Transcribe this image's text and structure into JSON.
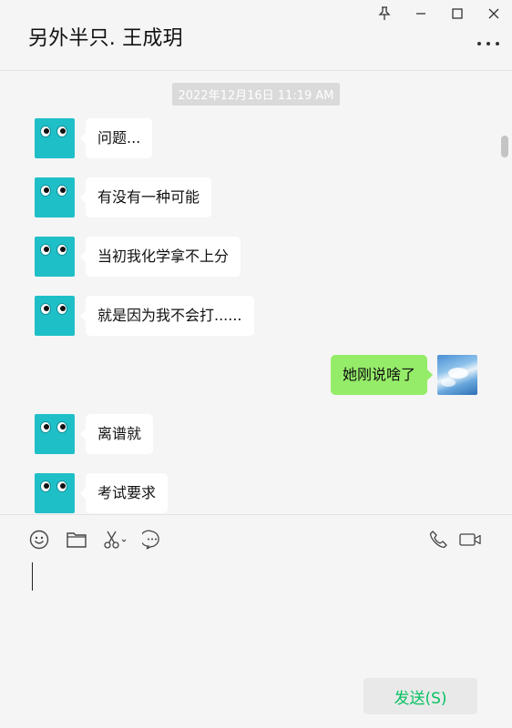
{
  "header": {
    "title": "另外半只. 王成玥"
  },
  "chat": {
    "timestamp": "2022年12月16日 11:19 AM",
    "messages": [
      {
        "side": "left",
        "text": "问题..."
      },
      {
        "side": "left",
        "text": "有没有一种可能"
      },
      {
        "side": "left",
        "text": "当初我化学拿不上分"
      },
      {
        "side": "left",
        "text": "就是因为我不会打......"
      },
      {
        "side": "right",
        "text": "她刚说啥了"
      },
      {
        "side": "left",
        "text": "离谱就"
      },
      {
        "side": "left",
        "text": "考试要求"
      }
    ]
  },
  "composer": {
    "send_label": "发送(S)"
  },
  "colors": {
    "accent": "#07c160",
    "self_bubble": "#95ec69",
    "avatar_teal": "#1fbfc8"
  },
  "icons": [
    "pin-icon",
    "minimize-icon",
    "maximize-icon",
    "close-icon",
    "more-icon",
    "emoji-icon",
    "folder-icon",
    "scissors-icon",
    "chat-history-icon",
    "phone-icon",
    "video-icon"
  ]
}
